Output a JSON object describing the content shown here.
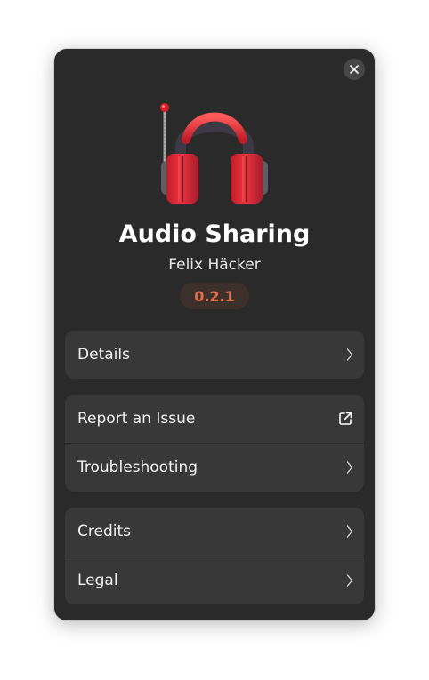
{
  "dialog": {
    "close_icon": "close-icon",
    "app_icon": "headphones-antenna-icon",
    "app_name": "Audio Sharing",
    "developer": "Felix Häcker",
    "version": "0.2.1",
    "accent_color": "#e96a45",
    "background_color": "#2a2a2a"
  },
  "groups": [
    {
      "rows": [
        {
          "label": "Details",
          "icon": "chevron-right-icon"
        }
      ]
    },
    {
      "rows": [
        {
          "label": "Report an Issue",
          "icon": "external-link-icon"
        },
        {
          "label": "Troubleshooting",
          "icon": "chevron-right-icon"
        }
      ]
    },
    {
      "rows": [
        {
          "label": "Credits",
          "icon": "chevron-right-icon"
        },
        {
          "label": "Legal",
          "icon": "chevron-right-icon"
        }
      ]
    }
  ]
}
